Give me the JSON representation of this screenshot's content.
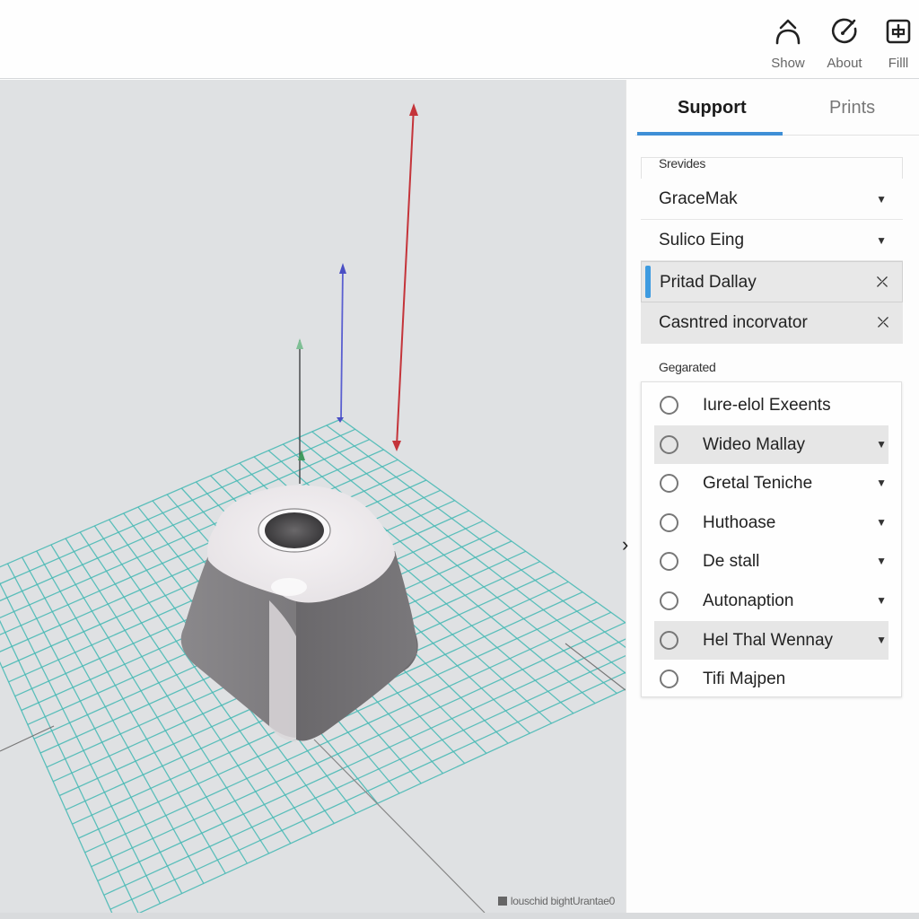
{
  "toolbar": {
    "tools": [
      {
        "label": "Show",
        "icon": "chevron-up-arc-icon"
      },
      {
        "label": "About",
        "icon": "compass-dial-icon"
      },
      {
        "label": "Filll",
        "icon": "fill-box-icon"
      }
    ]
  },
  "viewport": {
    "status_text": "louschid bightUrantae0",
    "axes": {
      "x_color": "#c4343a",
      "y_color": "#4a4fc4",
      "z_color": "#3f9a5e"
    },
    "grid_color": "#45b9b4",
    "collapse_arrow": "›"
  },
  "panel": {
    "tabs": [
      {
        "label": "Support",
        "active": true
      },
      {
        "label": "Prints",
        "active": false
      }
    ],
    "accent_color": "#3e8fd6",
    "group1": {
      "label": "Srevides",
      "items": [
        {
          "label": "GraceMak",
          "trailing": "chevron-down"
        },
        {
          "label": "Sulico Eing",
          "trailing": "chevron-down"
        },
        {
          "label": "Pritad Dallay",
          "trailing": "shuffle",
          "selected": true
        },
        {
          "label": "Casntred incorvator",
          "trailing": "shuffle",
          "highlighted": true
        }
      ]
    },
    "group2": {
      "label": "Gegarated",
      "items": [
        {
          "label": "Iure-elol Exeents",
          "chevron": false,
          "highlighted": false
        },
        {
          "label": "Wideo Mallay",
          "chevron": true,
          "highlighted": true
        },
        {
          "label": "Gretal Teniche",
          "chevron": true,
          "highlighted": false
        },
        {
          "label": "Huthoase",
          "chevron": true,
          "highlighted": false
        },
        {
          "label": "De stall",
          "chevron": true,
          "highlighted": false
        },
        {
          "label": "Autonaption",
          "chevron": true,
          "highlighted": false
        },
        {
          "label": "Hel Thal Wennay",
          "chevron": true,
          "highlighted": true
        },
        {
          "label": "Tifi Majpen",
          "chevron": false,
          "highlighted": false
        }
      ]
    }
  }
}
